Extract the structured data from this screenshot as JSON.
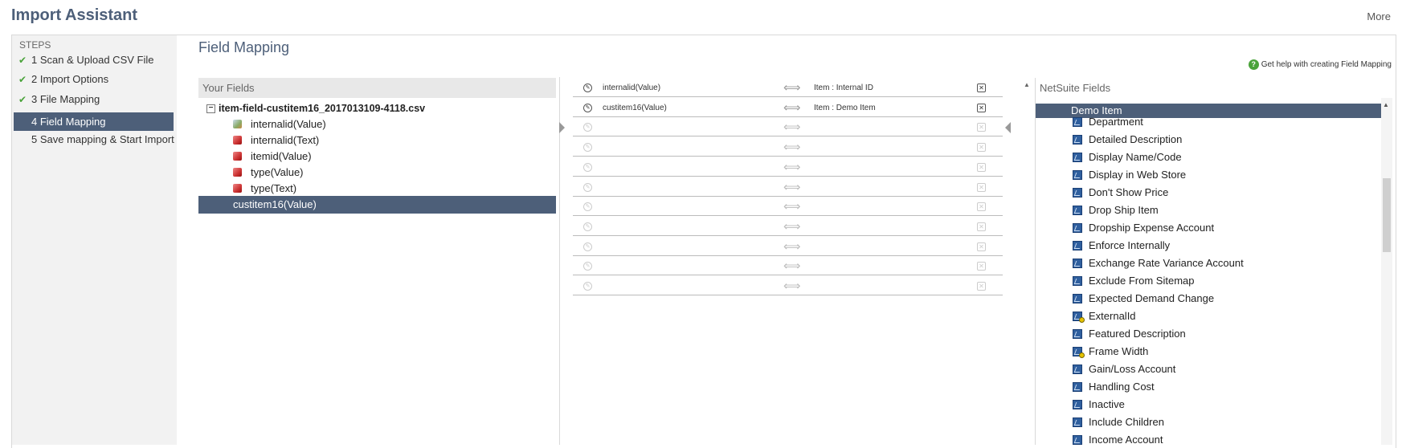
{
  "app": {
    "title": "Import Assistant",
    "more_label": "More"
  },
  "steps": {
    "label": "STEPS",
    "items": [
      {
        "label": "1 Scan & Upload CSV File",
        "done": true
      },
      {
        "label": "2 Import Options",
        "done": true
      },
      {
        "label": "3 File Mapping",
        "done": true
      },
      {
        "label": "4 Field Mapping",
        "active": true
      },
      {
        "label": "5 Save mapping & Start Import"
      }
    ]
  },
  "main": {
    "title": "Field Mapping",
    "help_label": "Get help with creating Field Mapping"
  },
  "your_fields": {
    "header": "Your Fields",
    "file_name": "item-field-custitem16_2017013109-4118.csv",
    "fields": [
      {
        "label": "internalid(Value)",
        "icon": "key-icon"
      },
      {
        "label": "internalid(Text)",
        "icon": "cube-icon"
      },
      {
        "label": "itemid(Value)",
        "icon": "cube-icon"
      },
      {
        "label": "type(Value)",
        "icon": "cube-icon"
      },
      {
        "label": "type(Text)",
        "icon": "cube-icon"
      },
      {
        "label": "custitem16(Value)",
        "selected": true
      }
    ]
  },
  "mapping": {
    "arrow_glyph": "⟺",
    "rows": [
      {
        "source": "internalid(Value)",
        "target": "Item : Internal ID"
      },
      {
        "source": "custitem16(Value)",
        "target": "Item : Demo Item"
      },
      {
        "source": "",
        "target": ""
      },
      {
        "source": "",
        "target": ""
      },
      {
        "source": "",
        "target": ""
      },
      {
        "source": "",
        "target": ""
      },
      {
        "source": "",
        "target": ""
      },
      {
        "source": "",
        "target": ""
      },
      {
        "source": "",
        "target": ""
      },
      {
        "source": "",
        "target": ""
      },
      {
        "source": "",
        "target": ""
      }
    ]
  },
  "netsuite_fields": {
    "header": "NetSuite Fields",
    "selected_group": "Demo Item",
    "items": [
      {
        "label": "Department"
      },
      {
        "label": "Detailed Description"
      },
      {
        "label": "Display Name/Code"
      },
      {
        "label": "Display in Web Store"
      },
      {
        "label": "Don't Show Price"
      },
      {
        "label": "Drop Ship Item"
      },
      {
        "label": "Dropship Expense Account"
      },
      {
        "label": "Enforce Internally"
      },
      {
        "label": "Exchange Rate Variance Account"
      },
      {
        "label": "Exclude From Sitemap"
      },
      {
        "label": "Expected Demand Change"
      },
      {
        "label": "ExternalId",
        "badge": true
      },
      {
        "label": "Featured Description"
      },
      {
        "label": "Frame Width",
        "badge": true
      },
      {
        "label": "Gain/Loss Account"
      },
      {
        "label": "Handling Cost"
      },
      {
        "label": "Inactive"
      },
      {
        "label": "Include Children"
      },
      {
        "label": "Income Account"
      }
    ]
  },
  "colors": {
    "accent": "#4d5f79",
    "check": "#4aa33a",
    "panel_header_bg": "#e8e8e8"
  }
}
